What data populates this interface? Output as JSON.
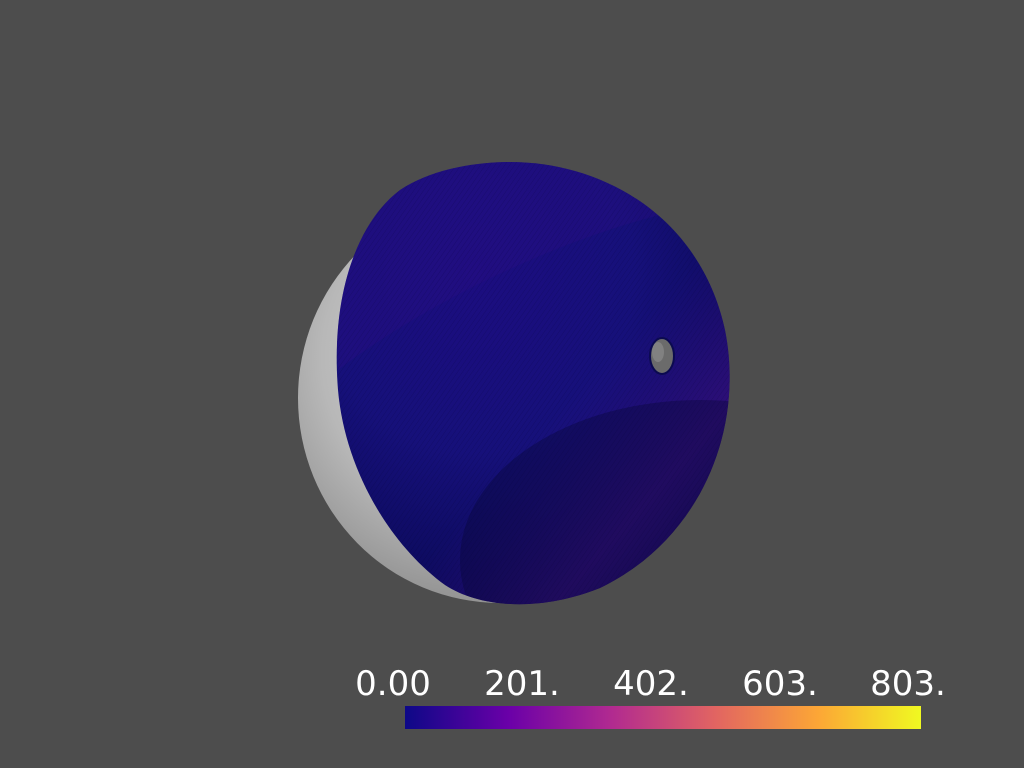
{
  "viewer": {
    "background": "#4d4d4d",
    "colormap": "plasma",
    "colormap_stops": [
      "#0d0887",
      "#6a00a8",
      "#b12a90",
      "#e16462",
      "#fca636",
      "#f0f921"
    ],
    "surface_color": "#1a0a78",
    "shadow_shell_color": "#bdbdbd"
  },
  "colorbar": {
    "tick_labels": [
      "0.00",
      "201.",
      "402.",
      "603.",
      "803."
    ],
    "range": [
      0,
      803
    ]
  }
}
